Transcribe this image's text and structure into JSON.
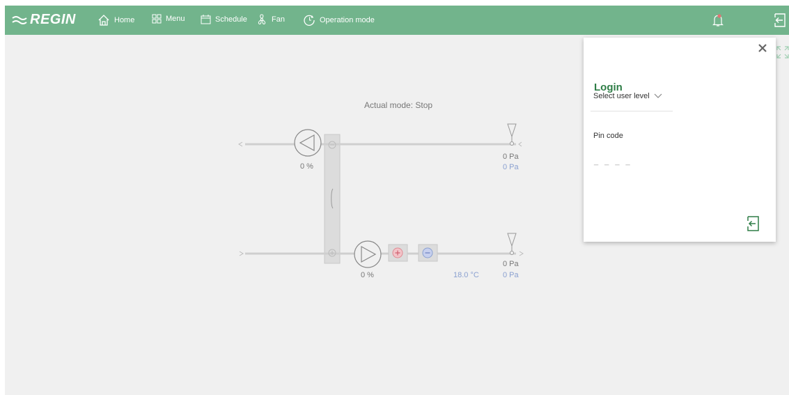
{
  "brand": {
    "name": "REGIN"
  },
  "nav": {
    "home": "Home",
    "menu": "Menu",
    "schedule": "Schedule",
    "fan": "Fan",
    "operation_mode": "Operation mode"
  },
  "colors": {
    "topbar": "#72b48c",
    "accent_green": "#2e7d46",
    "heater": "#e08a93",
    "cooler": "#8aa0d0"
  },
  "diagram": {
    "actual_mode": "Actual mode: Stop",
    "extract_fan_output": "0 %",
    "supply_fan_output": "0 %",
    "extract_pressure": "0 Pa",
    "extract_flow": "0 Pa",
    "supply_pressure": "0 Pa",
    "supply_flow": "0 Pa",
    "supply_temp": "18.0 °C"
  },
  "login": {
    "title": "Login",
    "user_level": "Select user level",
    "pin_label": "Pin code",
    "pin_placeholder": "_ _ _ _"
  }
}
